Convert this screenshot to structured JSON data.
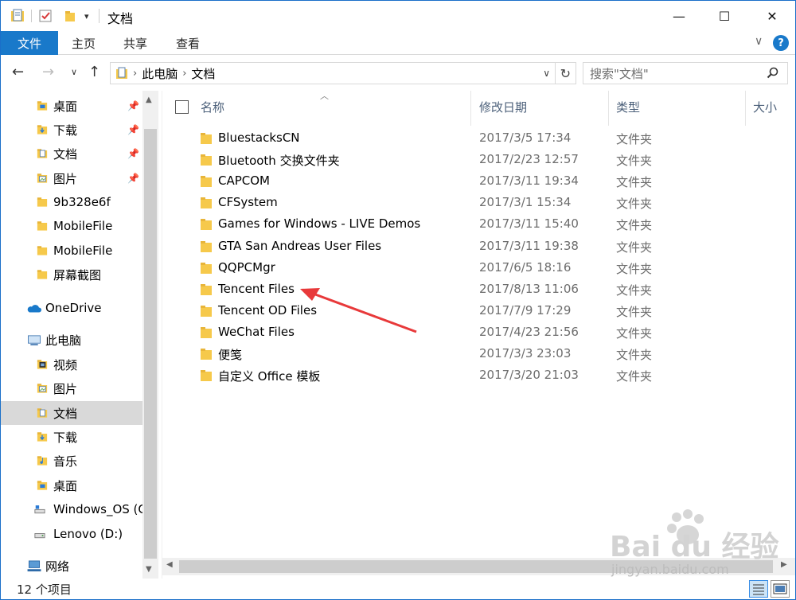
{
  "window": {
    "title": "文档",
    "minimize": "—",
    "maximize": "☐",
    "close": "✕"
  },
  "ribbon": {
    "file_tab": "文件",
    "tabs": [
      "主页",
      "共享",
      "查看"
    ],
    "expand": "∨",
    "help": "?"
  },
  "address": {
    "path": [
      "此电脑",
      "文档"
    ],
    "separator": "›",
    "refresh": "↻",
    "dropdown": "∨",
    "search_placeholder": "搜索\"文档\""
  },
  "nav_pane": {
    "quick_access": [
      {
        "label": "桌面",
        "icon": "desktop-folder-icon",
        "pinned": true
      },
      {
        "label": "下载",
        "icon": "downloads-folder-icon",
        "pinned": true
      },
      {
        "label": "文档",
        "icon": "documents-folder-icon",
        "pinned": true
      },
      {
        "label": "图片",
        "icon": "pictures-folder-icon",
        "pinned": true
      },
      {
        "label": "9b328e6f",
        "icon": "folder-icon",
        "pinned": false
      },
      {
        "label": "MobileFile",
        "icon": "folder-icon",
        "pinned": false
      },
      {
        "label": "MobileFile",
        "icon": "folder-icon",
        "pinned": false
      },
      {
        "label": "屏幕截图",
        "icon": "folder-icon",
        "pinned": false
      }
    ],
    "onedrive": "OneDrive",
    "this_pc": "此电脑",
    "pc_items": [
      {
        "label": "视频",
        "icon": "videos-folder-icon"
      },
      {
        "label": "图片",
        "icon": "pictures-folder-icon"
      },
      {
        "label": "文档",
        "icon": "documents-folder-icon",
        "selected": true
      },
      {
        "label": "下载",
        "icon": "downloads-folder-icon"
      },
      {
        "label": "音乐",
        "icon": "music-folder-icon"
      },
      {
        "label": "桌面",
        "icon": "desktop-folder-icon"
      },
      {
        "label": "Windows_OS (C",
        "icon": "drive-c-icon"
      },
      {
        "label": "Lenovo (D:)",
        "icon": "drive-d-icon"
      }
    ],
    "network": "网络"
  },
  "columns": {
    "name": "名称",
    "date": "修改日期",
    "type": "类型",
    "size": "大小"
  },
  "files": [
    {
      "name": "BluestacksCN",
      "date": "2017/3/5 17:34",
      "type": "文件夹"
    },
    {
      "name": "Bluetooth 交换文件夹",
      "date": "2017/2/23 12:57",
      "type": "文件夹"
    },
    {
      "name": "CAPCOM",
      "date": "2017/3/11 19:34",
      "type": "文件夹"
    },
    {
      "name": "CFSystem",
      "date": "2017/3/1 15:34",
      "type": "文件夹"
    },
    {
      "name": "Games for Windows - LIVE Demos",
      "date": "2017/3/11 15:40",
      "type": "文件夹"
    },
    {
      "name": "GTA San Andreas User Files",
      "date": "2017/3/11 19:38",
      "type": "文件夹"
    },
    {
      "name": "QQPCMgr",
      "date": "2017/6/5 18:16",
      "type": "文件夹"
    },
    {
      "name": "Tencent Files",
      "date": "2017/8/13 11:06",
      "type": "文件夹"
    },
    {
      "name": "Tencent OD Files",
      "date": "2017/7/9 17:29",
      "type": "文件夹"
    },
    {
      "name": "WeChat Files",
      "date": "2017/4/23 21:56",
      "type": "文件夹"
    },
    {
      "name": "便笺",
      "date": "2017/3/3 23:03",
      "type": "文件夹"
    },
    {
      "name": "自定义 Office 模板",
      "date": "2017/3/20 21:03",
      "type": "文件夹"
    }
  ],
  "status": {
    "item_count": "12 个项目"
  },
  "watermark": {
    "logo": "Bai du 经验",
    "url": "jingyan.baidu.com"
  },
  "colors": {
    "accent": "#1979ca",
    "annotation_arrow": "#e8393a",
    "folder": "#f6c94b"
  }
}
